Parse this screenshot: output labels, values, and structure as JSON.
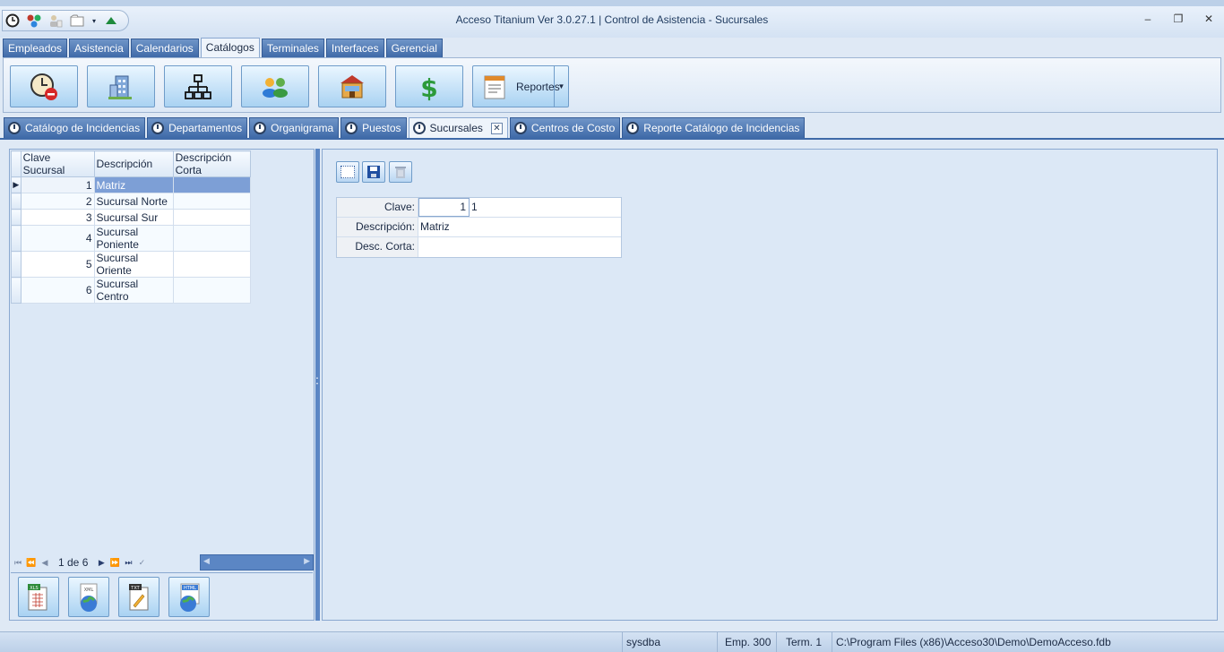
{
  "window": {
    "title": "Acceso Titanium  Ver 3.0.27.1 | Control de Asistencia - Sucursales",
    "minimize": "–",
    "maximize": "❐",
    "close": "✕"
  },
  "ribbon_tabs": [
    "Empleados",
    "Asistencia",
    "Calendarios",
    "Catálogos",
    "Terminales",
    "Interfaces",
    "Gerencial"
  ],
  "ribbon_active_tab": "Catálogos",
  "ribbon_buttons": {
    "reportes_label": "Reportes"
  },
  "doc_tabs": [
    "Catálogo de Incidencias",
    "Departamentos",
    "Organigrama",
    "Puestos",
    "Sucursales",
    "Centros de Costo",
    "Reporte Catálogo de Incidencias"
  ],
  "doc_active_tab": "Sucursales",
  "grid": {
    "columns": [
      "Clave Sucursal",
      "Descripción",
      "Descripción Corta"
    ],
    "rows": [
      {
        "clave": "1",
        "descripcion": "Matriz",
        "corta": ""
      },
      {
        "clave": "2",
        "descripcion": "Sucursal Norte",
        "corta": ""
      },
      {
        "clave": "3",
        "descripcion": "Sucursal Sur",
        "corta": ""
      },
      {
        "clave": "4",
        "descripcion": "Sucursal Poniente",
        "corta": ""
      },
      {
        "clave": "5",
        "descripcion": "Sucursal Oriente",
        "corta": ""
      },
      {
        "clave": "6",
        "descripcion": "Sucursal Centro",
        "corta": ""
      }
    ],
    "selected_row": 0
  },
  "navigator": {
    "page_text": "1 de 6"
  },
  "export_buttons": [
    "XLS",
    "XML",
    "TXT",
    "HTML"
  ],
  "form": {
    "clave_label": "Clave:",
    "clave_input": "1",
    "clave_value": "1",
    "descripcion_label": "Descripción:",
    "descripcion_value": "Matriz",
    "desc_corta_label": "Desc. Corta:",
    "desc_corta_value": ""
  },
  "statusbar": {
    "user": "sysdba",
    "emp": "Emp. 300",
    "term": "Term. 1",
    "path": "C:\\Program Files (x86)\\Acceso30\\Demo\\DemoAcceso.fdb"
  },
  "colors": {
    "accent_blue": "#3f6aa8",
    "selected_row": "#7d9fd6",
    "panel_bg": "#dce8f6"
  }
}
